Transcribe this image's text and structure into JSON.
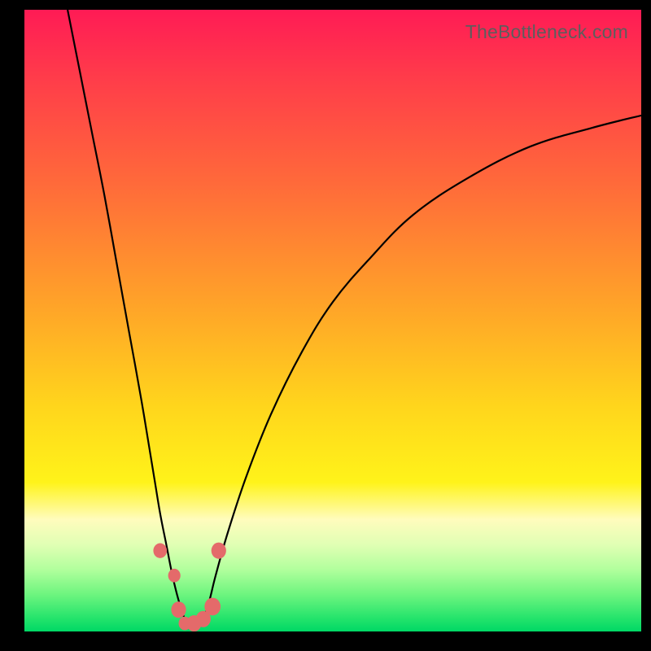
{
  "watermark": "TheBottleneck.com",
  "chart_data": {
    "type": "line",
    "title": "",
    "xlabel": "",
    "ylabel": "",
    "xlim": [
      0,
      100
    ],
    "ylim": [
      0,
      100
    ],
    "series": [
      {
        "name": "bottleneck-curve",
        "x": [
          7,
          9,
          11,
          13,
          15,
          17,
          19,
          21,
          22,
          23,
          24,
          25,
          26,
          27,
          28,
          29,
          30,
          31,
          33,
          36,
          40,
          45,
          50,
          56,
          63,
          72,
          82,
          92,
          100
        ],
        "y": [
          100,
          90,
          80,
          70,
          59,
          48,
          37,
          25,
          19,
          14,
          9,
          5,
          2,
          0.5,
          0.5,
          2,
          5,
          9,
          16,
          25,
          35,
          45,
          53,
          60,
          67,
          73,
          78,
          81,
          83
        ]
      }
    ],
    "markers": [
      {
        "x": 22.0,
        "y": 13.0,
        "r": 1.1
      },
      {
        "x": 24.3,
        "y": 9.0,
        "r": 1.0
      },
      {
        "x": 25.0,
        "y": 3.5,
        "r": 1.2
      },
      {
        "x": 26.0,
        "y": 1.3,
        "r": 1.0
      },
      {
        "x": 27.5,
        "y": 1.3,
        "r": 1.2
      },
      {
        "x": 29.0,
        "y": 2.0,
        "r": 1.2
      },
      {
        "x": 30.5,
        "y": 4.0,
        "r": 1.3
      },
      {
        "x": 31.5,
        "y": 13.0,
        "r": 1.2
      }
    ],
    "colors": {
      "curve": "#000000",
      "marker": "#e46a6a"
    }
  }
}
